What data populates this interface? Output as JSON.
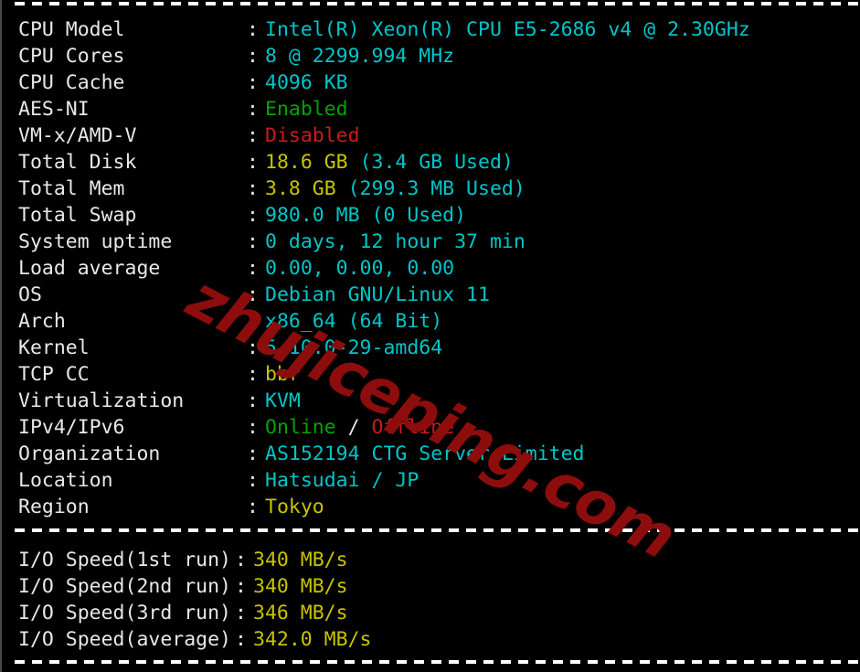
{
  "terminal": {
    "separator_char": "-",
    "watermark": "zhujiceping.com",
    "watermark_color": "#8d0d0d",
    "background_color": "#000000",
    "colors": {
      "label": "#e8e8e8",
      "cyan": "#00c5c7",
      "yellow": "#c7c400",
      "green": "#00a400",
      "red": "#c91b1b"
    }
  },
  "system_info": {
    "rows": [
      {
        "label": "CPU Model",
        "colon": ":",
        "parts": [
          {
            "text": "Intel(R) Xeon(R) CPU E5-2686 v4 @ 2.30GHz",
            "color": "cyan"
          }
        ]
      },
      {
        "label": "CPU Cores",
        "colon": ":",
        "parts": [
          {
            "text": "8 @ 2299.994 MHz",
            "color": "cyan"
          }
        ]
      },
      {
        "label": "CPU Cache",
        "colon": ":",
        "parts": [
          {
            "text": "4096 KB",
            "color": "cyan"
          }
        ]
      },
      {
        "label": "AES-NI",
        "colon": ":",
        "parts": [
          {
            "text": "Enabled",
            "color": "green"
          }
        ]
      },
      {
        "label": "VM-x/AMD-V",
        "colon": ":",
        "parts": [
          {
            "text": "Disabled",
            "color": "red"
          }
        ]
      },
      {
        "label": "Total Disk",
        "colon": ":",
        "parts": [
          {
            "text": "18.6 GB ",
            "color": "yellow"
          },
          {
            "text": "(3.4 GB Used)",
            "color": "cyan"
          }
        ]
      },
      {
        "label": "Total Mem",
        "colon": ":",
        "parts": [
          {
            "text": "3.8 GB ",
            "color": "yellow"
          },
          {
            "text": "(299.3 MB Used)",
            "color": "cyan"
          }
        ]
      },
      {
        "label": "Total Swap",
        "colon": ":",
        "parts": [
          {
            "text": "980.0 MB (0 Used)",
            "color": "cyan"
          }
        ]
      },
      {
        "label": "System uptime",
        "colon": ":",
        "parts": [
          {
            "text": "0 days, 12 hour 37 min",
            "color": "cyan"
          }
        ]
      },
      {
        "label": "Load average",
        "colon": ":",
        "parts": [
          {
            "text": "0.00, 0.00, 0.00",
            "color": "cyan"
          }
        ]
      },
      {
        "label": "OS",
        "colon": ":",
        "parts": [
          {
            "text": "Debian GNU/Linux 11",
            "color": "cyan"
          }
        ]
      },
      {
        "label": "Arch",
        "colon": ":",
        "parts": [
          {
            "text": "x86_64 (64 Bit)",
            "color": "cyan"
          }
        ]
      },
      {
        "label": "Kernel",
        "colon": ":",
        "parts": [
          {
            "text": "5.10.0-29-amd64",
            "color": "cyan"
          }
        ]
      },
      {
        "label": "TCP CC",
        "colon": ":",
        "parts": [
          {
            "text": "bbr",
            "color": "yellow"
          }
        ]
      },
      {
        "label": "Virtualization",
        "colon": ":",
        "parts": [
          {
            "text": "KVM",
            "color": "cyan"
          }
        ]
      },
      {
        "label": "IPv4/IPv6",
        "colon": ":",
        "parts": [
          {
            "text": "Online",
            "color": "green"
          },
          {
            "text": " / ",
            "color": "white"
          },
          {
            "text": "Offline",
            "color": "red"
          }
        ]
      },
      {
        "label": "Organization",
        "colon": ":",
        "parts": [
          {
            "text": "AS152194 CTG Server Limited",
            "color": "cyan"
          }
        ]
      },
      {
        "label": "Location",
        "colon": ":",
        "parts": [
          {
            "text": "Hatsudai / JP",
            "color": "cyan"
          }
        ]
      },
      {
        "label": "Region",
        "colon": ":",
        "parts": [
          {
            "text": "Tokyo",
            "color": "yellow"
          }
        ]
      }
    ]
  },
  "io_speed": {
    "rows": [
      {
        "label": "I/O Speed(1st run)",
        "colon": ":",
        "parts": [
          {
            "text": "340 MB/s",
            "color": "yellow"
          }
        ]
      },
      {
        "label": "I/O Speed(2nd run)",
        "colon": ":",
        "parts": [
          {
            "text": "340 MB/s",
            "color": "yellow"
          }
        ]
      },
      {
        "label": "I/O Speed(3rd run)",
        "colon": ":",
        "parts": [
          {
            "text": "346 MB/s",
            "color": "yellow"
          }
        ]
      },
      {
        "label": "I/O Speed(average)",
        "colon": ":",
        "parts": [
          {
            "text": "342.0 MB/s",
            "color": "yellow"
          }
        ]
      }
    ]
  }
}
